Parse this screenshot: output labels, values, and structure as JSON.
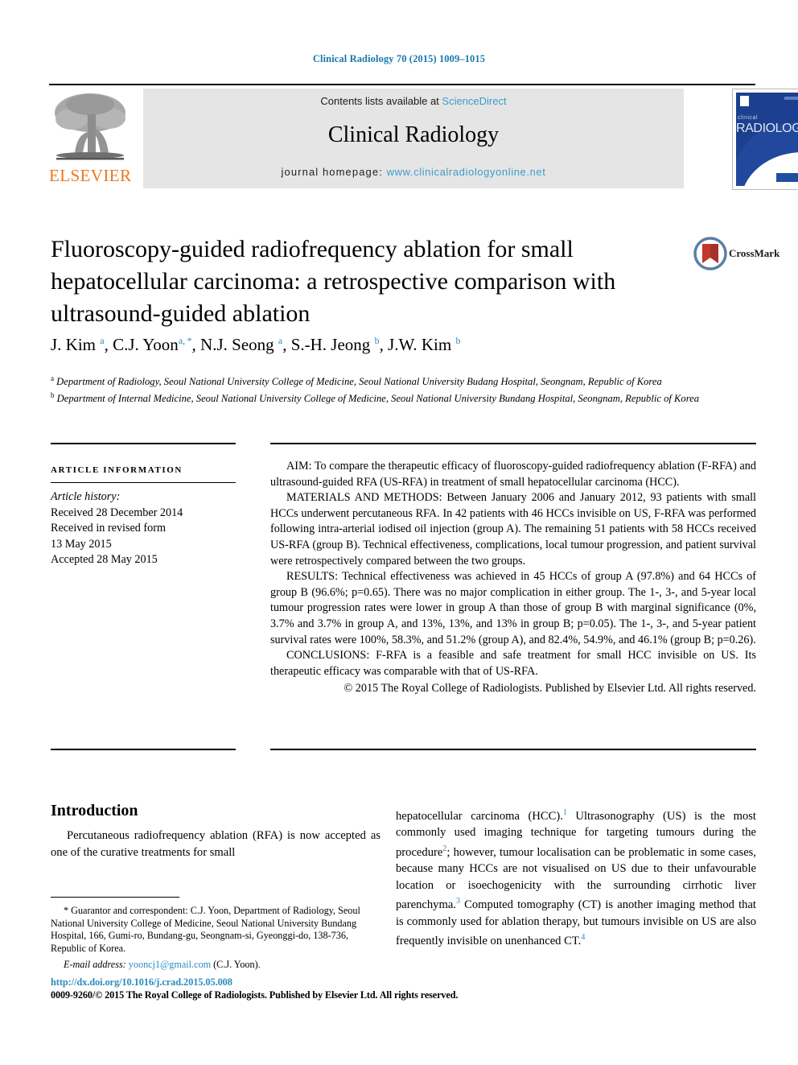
{
  "running_head": "Clinical Radiology 70 (2015) 1009–1015",
  "masthead": {
    "publisher_logo_text": "ELSEVIER",
    "contents_prefix": "Contents lists available at ",
    "contents_link": "ScienceDirect",
    "journal_title": "Clinical Radiology",
    "homepage_label": "journal homepage: ",
    "homepage_url": "www.clinicalradiologyonline.net",
    "cover": {
      "journal_small": "clinical",
      "journal_big": "RADIOLOGY"
    },
    "accent_link_color": "#3e9bc9",
    "band_background": "#e5e5e5",
    "elsevier_orange": "#e87722"
  },
  "article": {
    "title": "Fluoroscopy-guided radiofrequency ablation for small hepatocellular carcinoma: a retrospective comparison with ultrasound-guided ablation",
    "crossmark_label": "CrossMark",
    "authors_html": "J. Kim <sup>a</sup>, C.J. Yoon<sup>a, *</sup>, N.J. Seong <sup>a</sup>, S.-H. Jeong <sup>b</sup>, J.W. Kim <sup>b</sup>",
    "affiliations": [
      {
        "marker": "a",
        "text": "Department of Radiology, Seoul National University College of Medicine, Seoul National University Budang Hospital, Seongnam, Republic of Korea"
      },
      {
        "marker": "b",
        "text": "Department of Internal Medicine, Seoul National University College of Medicine, Seoul National University Bundang Hospital, Seongnam, Republic of Korea"
      }
    ]
  },
  "article_information": {
    "heading": "ARTICLE INFORMATION",
    "history_label": "Article history:",
    "history_lines": [
      "Received 28 December 2014",
      "Received in revised form",
      "13 May 2015",
      "Accepted 28 May 2015"
    ]
  },
  "abstract": {
    "aim": "AIM: To compare the therapeutic efficacy of fluoroscopy-guided radiofrequency ablation (F-RFA) and ultrasound-guided RFA (US-RFA) in treatment of small hepatocellular carcinoma (HCC).",
    "materials_and_methods": "MATERIALS AND METHODS: Between January 2006 and January 2012, 93 patients with small HCCs underwent percutaneous RFA. In 42 patients with 46 HCCs invisible on US, F-RFA was performed following intra-arterial iodised oil injection (group A). The remaining 51 patients with 58 HCCs received US-RFA (group B). Technical effectiveness, complications, local tumour progression, and patient survival were retrospectively compared between the two groups.",
    "results": "RESULTS: Technical effectiveness was achieved in 45 HCCs of group A (97.8%) and 64 HCCs of group B (96.6%; p=0.65). There was no major complication in either group. The 1-, 3-, and 5-year local tumour progression rates were lower in group A than those of group B with marginal significance (0%, 3.7% and 3.7% in group A, and 13%, 13%, and 13% in group B; p=0.05). The 1-, 3-, and 5-year patient survival rates were 100%, 58.3%, and 51.2% (group A), and 82.4%, 54.9%, and 46.1% (group B; p=0.26).",
    "conclusions": "CONCLUSIONS: F-RFA is a feasible and safe treatment for small HCC invisible on US. Its therapeutic efficacy was comparable with that of US-RFA.",
    "copyright": "© 2015 The Royal College of Radiologists. Published by Elsevier Ltd. All rights reserved."
  },
  "body": {
    "introduction_heading": "Introduction",
    "left_column_text": "Percutaneous radiofrequency ablation (RFA) is now accepted as one of the curative treatments for small",
    "right_column_html": "hepatocellular carcinoma (HCC).<sup>1</sup> Ultrasonography (US) is the most commonly used imaging technique for targeting tumours during the procedure<sup>2</sup>; however, tumour localisation can be problematic in some cases, because many HCCs are not visualised on US due to their unfavourable location or isoechogenicity with the surrounding cirrhotic liver parenchyma.<sup>3</sup> Computed tomography (CT) is another imaging method that is commonly used for ablation therapy, but tumours invisible on US are also frequently invisible on unenhanced CT.<sup>4</sup>"
  },
  "footnote": {
    "correspondence": "* Guarantor and correspondent: C.J. Yoon, Department of Radiology, Seoul National University College of Medicine, Seoul National University Bundang Hospital, 166, Gumi-ro, Bundang-gu, Seongnam-si, Gyeonggi-do, 138-736, Republic of Korea.",
    "email_label": "E-mail address:",
    "email": "yooncj1@gmail.com",
    "email_suffix": "(C.J. Yoon).",
    "doi": "http://dx.doi.org/10.1016/j.crad.2015.05.008",
    "issn_line": "0009-9260/© 2015 The Royal College of Radiologists. Published by Elsevier Ltd. All rights reserved."
  }
}
